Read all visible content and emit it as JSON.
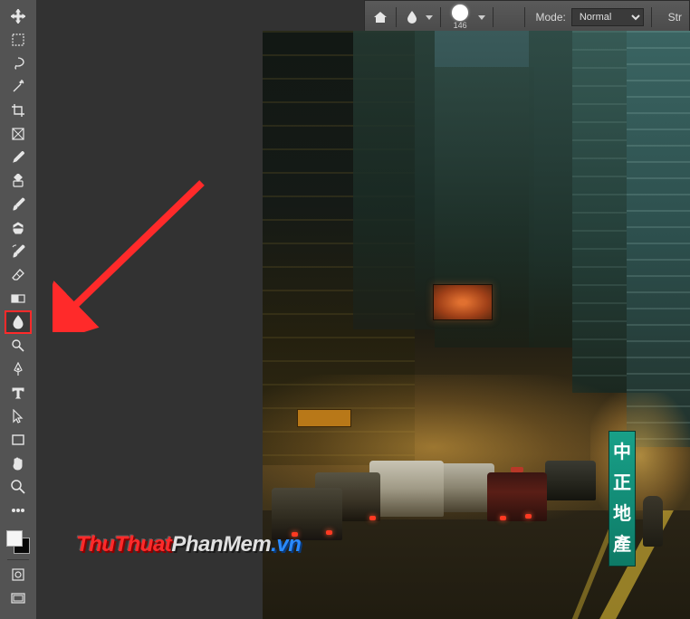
{
  "toolbar": {
    "tools": [
      {
        "name": "move-tool"
      },
      {
        "name": "artboard-tool"
      },
      {
        "name": "lasso-tool"
      },
      {
        "name": "magic-wand-tool"
      },
      {
        "name": "crop-tool"
      },
      {
        "name": "frame-tool"
      },
      {
        "name": "eyedropper-tool"
      },
      {
        "name": "healing-brush-tool"
      },
      {
        "name": "brush-tool"
      },
      {
        "name": "clone-stamp-tool"
      },
      {
        "name": "history-brush-tool"
      },
      {
        "name": "eraser-tool"
      },
      {
        "name": "gradient-tool"
      },
      {
        "name": "blur-tool"
      },
      {
        "name": "dodge-tool"
      },
      {
        "name": "pen-tool"
      },
      {
        "name": "type-tool"
      },
      {
        "name": "path-selection-tool"
      },
      {
        "name": "rectangle-tool"
      },
      {
        "name": "hand-tool"
      },
      {
        "name": "zoom-tool"
      }
    ],
    "highlighted_index": 13,
    "foreground_color": "#ffffff",
    "background_color": "#000000"
  },
  "options_bar": {
    "brush_size": "146",
    "mode_label": "Mode:",
    "mode_value": "Normal",
    "strength_label": "Str"
  },
  "annotation": {
    "type": "arrow",
    "target": "blur-tool",
    "color": "#ff2a2a"
  },
  "watermark": {
    "part1": "ThuThuat",
    "part2": "PhanMem",
    "part3": ".vn"
  },
  "canvas": {
    "sign_text": [
      "中",
      "正",
      "地",
      "產"
    ]
  }
}
